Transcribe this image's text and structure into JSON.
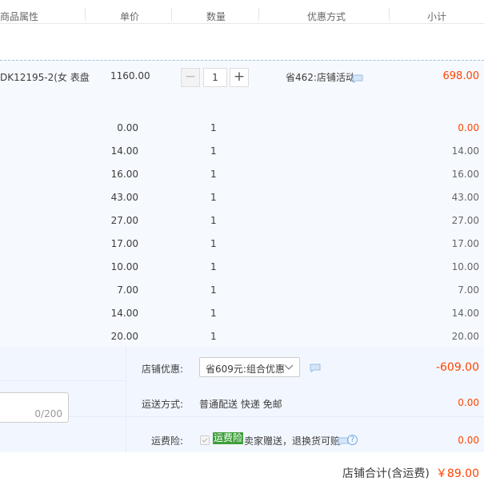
{
  "header": {
    "col_attr": "商品属性",
    "col_price": "单价",
    "col_qty": "数量",
    "col_promo": "优惠方式",
    "col_subtotal": "小计"
  },
  "main_item": {
    "attr": "DK12195-2(女 表盘",
    "price": "1160.00",
    "quantity": "1",
    "minus": "−",
    "plus": "+",
    "promo": "省462:店铺活动",
    "subtotal": "698.00"
  },
  "gift_rows": [
    {
      "price": "0.00",
      "qty": "1",
      "subtotal": "0.00",
      "highlight": true
    },
    {
      "price": "14.00",
      "qty": "1",
      "subtotal": "14.00",
      "highlight": false
    },
    {
      "price": "16.00",
      "qty": "1",
      "subtotal": "16.00",
      "highlight": false
    },
    {
      "price": "43.00",
      "qty": "1",
      "subtotal": "43.00",
      "highlight": false
    },
    {
      "price": "27.00",
      "qty": "1",
      "subtotal": "27.00",
      "highlight": false
    },
    {
      "price": "17.00",
      "qty": "1",
      "subtotal": "17.00",
      "highlight": false
    },
    {
      "price": "10.00",
      "qty": "1",
      "subtotal": "10.00",
      "highlight": false
    },
    {
      "price": "7.00",
      "qty": "1",
      "subtotal": "7.00",
      "highlight": false
    },
    {
      "price": "14.00",
      "qty": "1",
      "subtotal": "14.00",
      "highlight": false
    },
    {
      "price": "20.00",
      "qty": "1",
      "subtotal": "20.00",
      "highlight": false
    }
  ],
  "message": {
    "char_count": "0/200"
  },
  "shop_discount": {
    "label": "店铺优惠:",
    "selected": "省609元:组合优惠",
    "amount": "-609.00"
  },
  "shipping": {
    "label": "运送方式:",
    "method": "普通配送 快递 免邮",
    "amount": "0.00"
  },
  "insurance": {
    "label": "运费险:",
    "badge": "运费险",
    "text": "卖家赠送，退换货可赔",
    "help": "?",
    "amount": "0.00"
  },
  "total": {
    "label": "店铺合计(含运费)",
    "value": "￥89.00"
  },
  "colors": {
    "accent_red": "#ff4400",
    "insurance_green": "#3d9e3a",
    "row_bg": "#f6f9fe"
  }
}
